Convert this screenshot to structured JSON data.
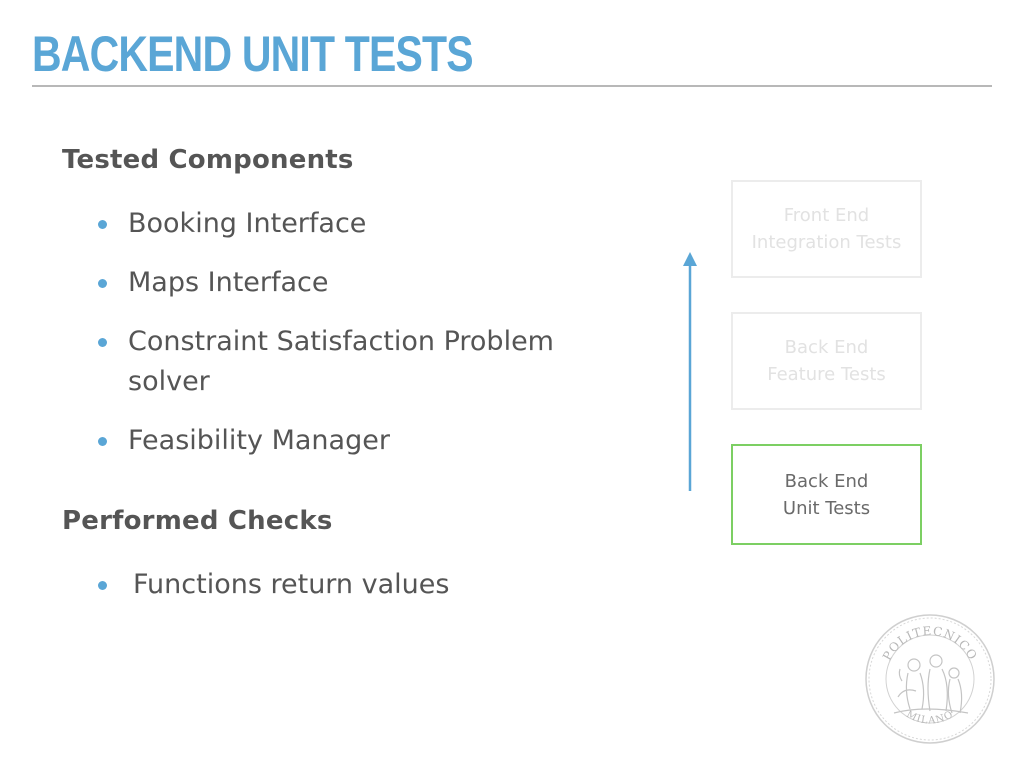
{
  "title": "BACKEND UNIT TESTS",
  "sections": [
    {
      "heading": "Tested Components",
      "items": [
        "Booking Interface",
        "Maps Interface",
        "Constraint Satisfaction Problem solver",
        "Feasibility Manager"
      ]
    },
    {
      "heading": "Performed Checks",
      "items": [
        "Functions return values"
      ]
    }
  ],
  "pipeline": {
    "stages": [
      {
        "line1": "Front End",
        "line2": "Integration Tests",
        "state": "inactive"
      },
      {
        "line1": "Back End",
        "line2": "Feature Tests",
        "state": "inactive"
      },
      {
        "line1": "Back End",
        "line2": "Unit Tests",
        "state": "active"
      }
    ],
    "arrow_icon": "arrow-up-icon"
  },
  "logo": {
    "text_top": "POLITECNICO",
    "text_bottom": "MILANO"
  },
  "colors": {
    "accent": "#5aa6d6",
    "text": "#555555",
    "active_border": "#7ccf63",
    "inactive_border": "#ececec"
  }
}
